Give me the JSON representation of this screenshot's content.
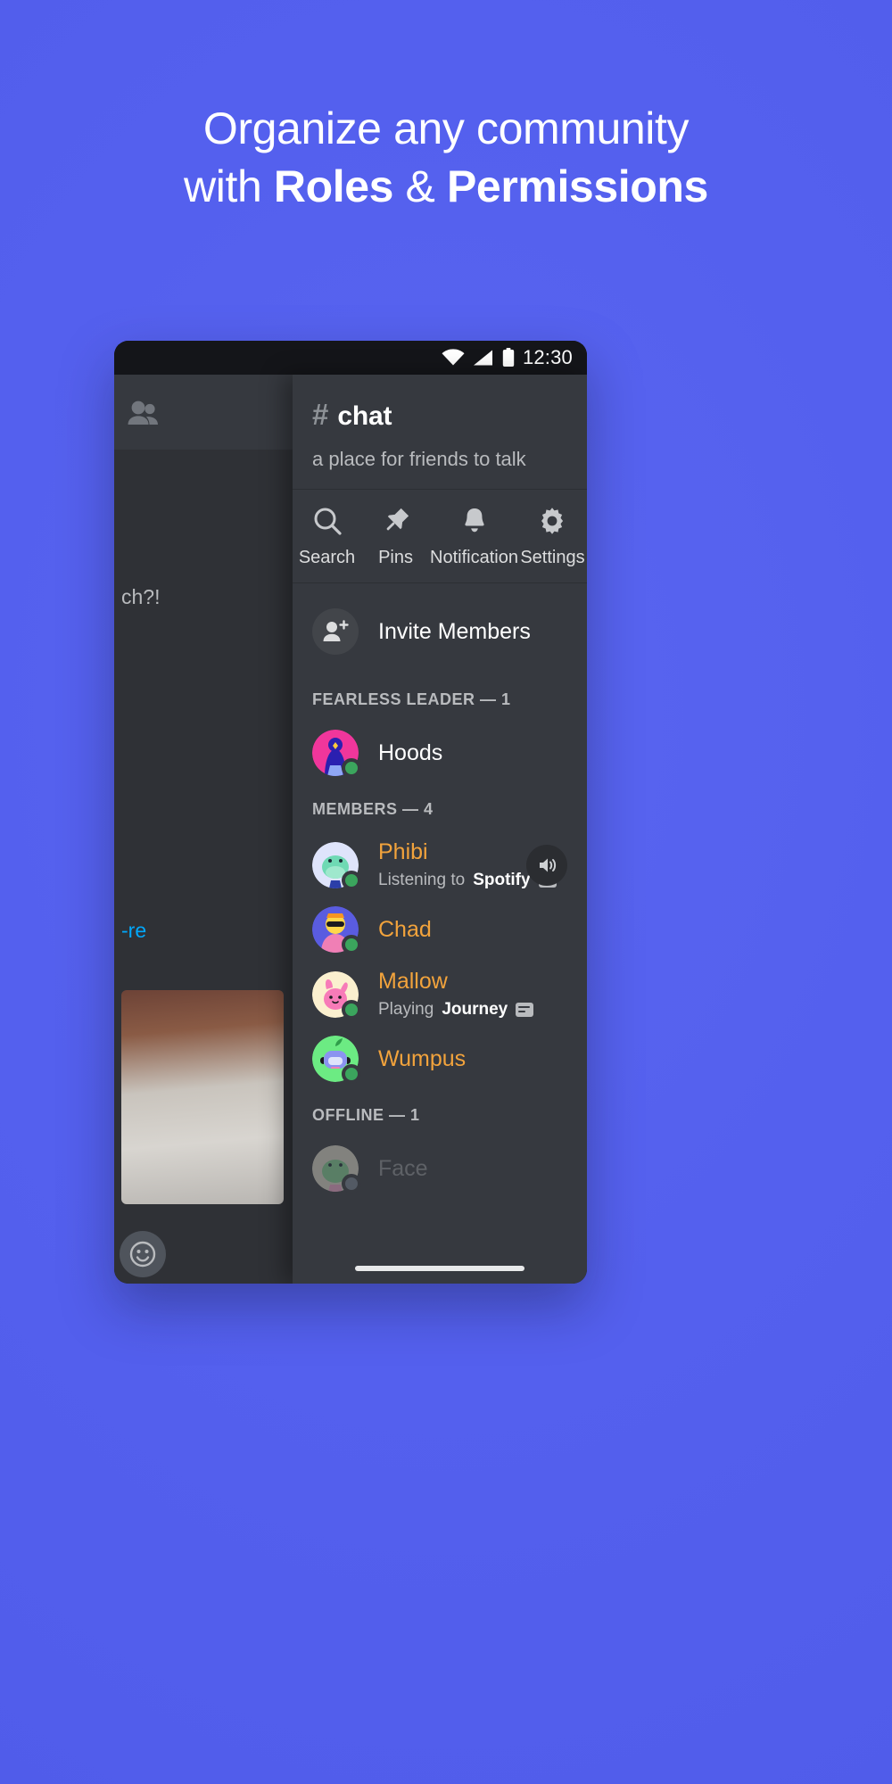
{
  "promo": {
    "line1": "Organize any community",
    "line2_plain_a": "with ",
    "line2_bold_a": "Roles",
    "line2_plain_b": " & ",
    "line2_bold_b": "Permissions",
    "background_color": "#5560ee"
  },
  "status_bar": {
    "time": "12:30",
    "icons": [
      "wifi-icon",
      "signal-icon",
      "battery-icon"
    ]
  },
  "background_chat": {
    "people_icon": "people-icon",
    "snippet_a": "ch?!",
    "snippet_b": "-re",
    "emoji_icon": "emoji-icon"
  },
  "channel": {
    "hash": "#",
    "name": "chat",
    "topic": "a place for friends to talk"
  },
  "actions": [
    {
      "label": "Search",
      "icon": "search-icon"
    },
    {
      "label": "Pins",
      "icon": "pin-icon"
    },
    {
      "label": "Notification",
      "icon": "bell-icon"
    },
    {
      "label": "Settings",
      "icon": "gear-icon"
    }
  ],
  "invite": {
    "label": "Invite Members",
    "icon": "person-add-icon"
  },
  "groups": [
    {
      "header": "FEARLESS LEADER — 1",
      "members": [
        {
          "name": "Hoods",
          "name_color": "#ffffff",
          "status_text": "",
          "status_bold": "",
          "presence": "online",
          "avatar": "avatar-hoods",
          "mute_icon": ""
        }
      ]
    },
    {
      "header": "MEMBERS — 4",
      "members": [
        {
          "name": "Phibi",
          "name_color": "#f2a33c",
          "status_text": "Listening to ",
          "status_bold": "Spotify",
          "presence": "online",
          "avatar": "avatar-phibi",
          "mute_icon": "speaker-icon"
        },
        {
          "name": "Chad",
          "name_color": "#f2a33c",
          "status_text": "",
          "status_bold": "",
          "presence": "online",
          "avatar": "avatar-chad",
          "mute_icon": ""
        },
        {
          "name": "Mallow",
          "name_color": "#f2a33c",
          "status_text": "Playing ",
          "status_bold": "Journey",
          "presence": "online",
          "avatar": "avatar-mallow",
          "mute_icon": ""
        },
        {
          "name": "Wumpus",
          "name_color": "#f2a33c",
          "status_text": "",
          "status_bold": "",
          "presence": "online",
          "avatar": "avatar-wumpus",
          "mute_icon": ""
        }
      ]
    },
    {
      "header": "OFFLINE — 1",
      "members": [
        {
          "name": "Face",
          "name_color": "#8a8d91",
          "status_text": "",
          "status_bold": "",
          "presence": "offline",
          "avatar": "avatar-face",
          "mute_icon": ""
        }
      ]
    }
  ]
}
